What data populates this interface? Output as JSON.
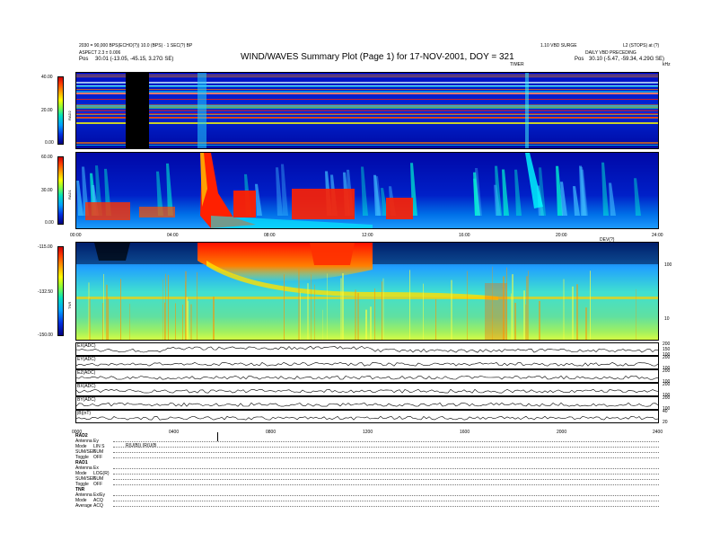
{
  "header": {
    "title": "WIND/WAVES Summary Plot (Page 1) for 17-NOV-2001, DOY = 321",
    "left_line1": "2030 = 90,000 BPS(ECHO(?)) 10.0 (BPS) · 1 SEC(?) BP",
    "left_line2": "ASPECT 2.3 ± 0.006",
    "left_line3": "Pos",
    "left_pos": "30.01 (-13.05, -45.15, 3.27G SE)",
    "right_line1": "1.10 VBD SURGE",
    "right_line2": "L2 (STOPS) at (?)",
    "right_line3": "DAILY VBD PRECEDING",
    "right_pos_label": "Pos",
    "right_pos": "30.10 (-5.47, -59.34, 4.29G SE)",
    "right_small": "TIMER",
    "right_unit": "kHz"
  },
  "colors": {
    "high": "#d00000",
    "mid": "#ffff00",
    "low": "#0030e0",
    "background": "#0000a0"
  },
  "chart_data": [
    {
      "type": "heatmap",
      "panel": "RAD2",
      "ylabel": "RAD2",
      "colorbar_ticks": [
        "40.00",
        "20.00",
        "0.00"
      ],
      "x_ticks": [],
      "notes": "high-frequency receiver dynamic spectrum"
    },
    {
      "type": "heatmap",
      "panel": "RAD1",
      "ylabel": "RAD1",
      "colorbar_ticks": [
        "60.00",
        "30.00",
        "0.00"
      ],
      "x_ticks": [
        "00:00",
        "04:00",
        "08:00",
        "12:00",
        "16:00",
        "20:00",
        "24:00"
      ],
      "xlabel": "",
      "x_unit_label": "DEV(?)"
    },
    {
      "type": "heatmap",
      "panel": "TNR",
      "ylabel": "TNR",
      "colorbar_ticks": [
        "-115.00",
        "-132.50",
        "-150.00"
      ],
      "right_ticks": [
        "100",
        "10"
      ]
    },
    {
      "type": "line",
      "panels": [
        {
          "label": "EX(ADC)",
          "right_ticks": [
            "200",
            "150",
            "100"
          ]
        },
        {
          "label": "EY(ADC)",
          "right_ticks": [
            "200",
            "100"
          ]
        },
        {
          "label": "EZ(ADC)",
          "right_ticks": [
            "200",
            "100"
          ]
        },
        {
          "label": "BX(ADC)",
          "right_ticks": [
            "200",
            "100"
          ]
        },
        {
          "label": "BY(ADC)",
          "right_ticks": [
            "200",
            "100"
          ]
        },
        {
          "label": "|B|(nT)",
          "right_ticks": [
            "40",
            "20"
          ]
        }
      ],
      "x_ticks": [
        "0000",
        "0400",
        "0800",
        "1200",
        "1600",
        "2000",
        "2400"
      ]
    }
  ],
  "footer": {
    "rad2_title": "RAD2",
    "rad2_rows": [
      {
        "k": "Antenna",
        "v": "Ey"
      },
      {
        "k": "Mode",
        "v": "LIN S"
      },
      {
        "k": "SUM/SEP",
        "v": "SUM"
      },
      {
        "k": "Toggle",
        "v": "OFF"
      }
    ],
    "rad2_mid": "R(U(B))  (R(U(B",
    "rad1_title": "RAD1",
    "rad1_rows": [
      {
        "k": "Antenna",
        "v": "Ex"
      },
      {
        "k": "Mode",
        "v": "LOG(R)"
      },
      {
        "k": "SUM/SEP",
        "v": "SUM"
      },
      {
        "k": "Toggle",
        "v": "OFF"
      }
    ],
    "tnr_title": "TNR",
    "tnr_rows": [
      {
        "k": "Antenna",
        "v": "Ex/Ey"
      },
      {
        "k": "Mode",
        "v": "ACQ"
      },
      {
        "k": "Average",
        "v": "ACQ"
      }
    ]
  }
}
